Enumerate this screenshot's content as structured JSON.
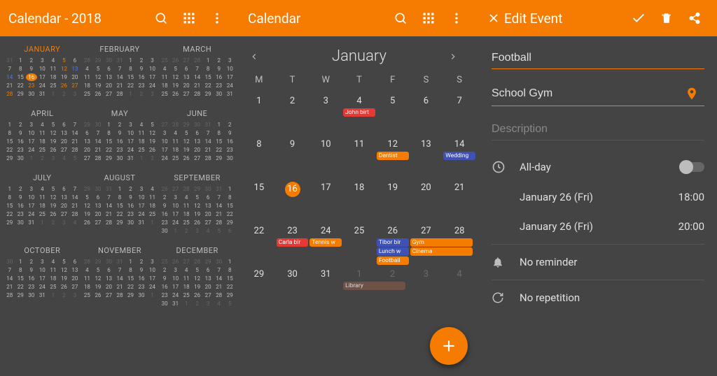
{
  "pane1": {
    "title": "Calendar - 2018",
    "months": [
      "JANUARY",
      "FEBRUARY",
      "MARCH",
      "APRIL",
      "MAY",
      "JUNE",
      "JULY",
      "AUGUST",
      "SEPTEMBER",
      "OCTOBER",
      "NOVEMBER",
      "DECEMBER"
    ],
    "current_month_index": 0,
    "today_day": 16
  },
  "pane2": {
    "title": "Calendar",
    "month": "January",
    "dow": [
      "M",
      "T",
      "W",
      "T",
      "F",
      "S",
      "S"
    ],
    "today": 16,
    "weeks": [
      [
        1,
        2,
        3,
        4,
        5,
        6,
        7
      ],
      [
        8,
        9,
        10,
        11,
        12,
        13,
        14
      ],
      [
        15,
        16,
        17,
        18,
        19,
        20,
        21
      ],
      [
        22,
        23,
        24,
        25,
        26,
        27,
        28
      ],
      [
        29,
        30,
        31,
        1,
        2,
        3,
        4
      ]
    ],
    "events": {
      "4": [
        {
          "label": "John birt",
          "color": "red"
        }
      ],
      "12": [
        {
          "label": "Dentist",
          "color": "orange"
        }
      ],
      "14": [
        {
          "label": "Wedding",
          "color": "blue"
        }
      ],
      "23": [
        {
          "label": "Carla bir",
          "color": "red"
        }
      ],
      "24": [
        {
          "label": "Tennis w",
          "color": "orange"
        }
      ],
      "26": [
        {
          "label": "Tibor bir",
          "color": "blue"
        },
        {
          "label": "Lunch w",
          "color": "blue"
        },
        {
          "label": "Football",
          "color": "orange"
        }
      ],
      "27-28": [
        {
          "label": "Gym",
          "color": "orange"
        },
        {
          "label": "Cinema",
          "color": "orange"
        }
      ],
      "next2": [
        {
          "label": "Library",
          "color": "brown"
        }
      ]
    }
  },
  "pane3": {
    "title": "Edit Event",
    "event_title": "Football",
    "location": "School Gym",
    "description_placeholder": "Description",
    "allday_label": "All-day",
    "start_date": "January 26 (Fri)",
    "start_time": "18:00",
    "end_date": "January 26 (Fri)",
    "end_time": "20:00",
    "reminder": "No reminder",
    "repetition": "No repetition"
  }
}
